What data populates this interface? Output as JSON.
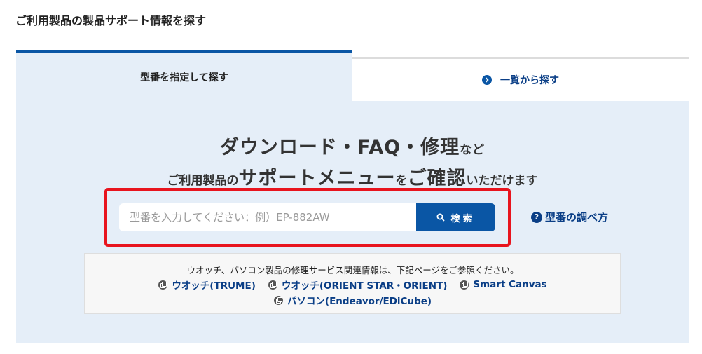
{
  "page_title": "ご利用製品の製品サポート情報を探す",
  "tabs": {
    "active_label": "型番を指定して探す",
    "inactive_label": "一覧から探す",
    "inactive_icon": "circle-arrow-right-icon"
  },
  "headline": {
    "line1_main": "ダウンロード・FAQ・修理",
    "line1_suffix": "など",
    "line2_part1": "ご利用製品の",
    "line2_part2": "サポートメニュー",
    "line2_part3": "を",
    "line2_part4": "ご確認",
    "line2_part5": "いただけます"
  },
  "search": {
    "placeholder": "型番を入力してください：例）EP-882AW",
    "button_label": "検索",
    "button_icon": "search-icon"
  },
  "help_link": {
    "label": "型番の調べ方",
    "icon": "question-circle-icon"
  },
  "info": {
    "text": "ウオッチ、パソコン製品の修理サービス関連情報は、下記ページをご参照ください。",
    "links": [
      {
        "label": "ウオッチ(TRUME)"
      },
      {
        "label": "ウオッチ(ORIENT STAR・ORIENT)"
      },
      {
        "label": "Smart Canvas"
      },
      {
        "label": "パソコン(Endeavor/EDiCube)"
      }
    ],
    "link_icon": "external-window-icon"
  },
  "colors": {
    "accent": "#0a56a5",
    "link": "#0a3e86",
    "panel_bg": "#e5eef8",
    "highlight": "#e8141e"
  }
}
